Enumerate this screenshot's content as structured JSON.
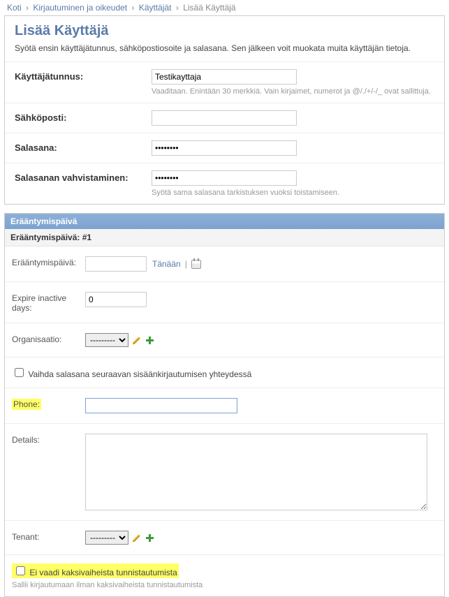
{
  "breadcrumb": {
    "home": "Koti",
    "auth": "Kirjautuminen ja oikeudet",
    "users": "Käyttäjät",
    "current": "Lisää Käyttäjä"
  },
  "page": {
    "title": "Lisää Käyttäjä",
    "subtitle": "Syötä ensin käyttäjätunnus, sähköpostiosoite ja salasana. Sen jälkeen voit muokata muita käyttäjän tietoja."
  },
  "form": {
    "username_label": "Käyttäjätunnus:",
    "username_value": "Testikayttaja",
    "username_help": "Vaaditaan. Enintään 30 merkkiä. Vain kirjaimet, numerot ja @/./+/-/_ ovat sallittuja.",
    "email_label": "Sähköposti:",
    "email_value": "",
    "password_label": "Salasana:",
    "password_value": "••••••••",
    "password2_label": "Salasanan vahvistaminen:",
    "password2_value": "••••••••",
    "password2_help": "Syötä sama salasana tarkistuksen vuoksi toistamiseen."
  },
  "expiry": {
    "module_title": "Erääntymispäivä",
    "sub_title": "Erääntymispäivä: #1",
    "date_label": "Erääntymispäivä:",
    "date_value": "",
    "today_label": "Tänään",
    "inactive_label": "Expire inactive days:",
    "inactive_value": "0",
    "org_label": "Organisaatio:",
    "org_selected": "---------",
    "change_pw_label": "Vaihda salasana seuraavan sisäänkirjautumisen yhteydessä",
    "phone_label": "Phone:",
    "phone_value": "",
    "details_label": "Details:",
    "details_value": "",
    "tenant_label": "Tenant:",
    "tenant_selected": "---------",
    "no2fa_label": "Ei vaadi kaksivaiheista tunnistautumista",
    "no2fa_help": "Sallii kirjautumaan ilman kaksivaiheista tunnistautumista"
  }
}
